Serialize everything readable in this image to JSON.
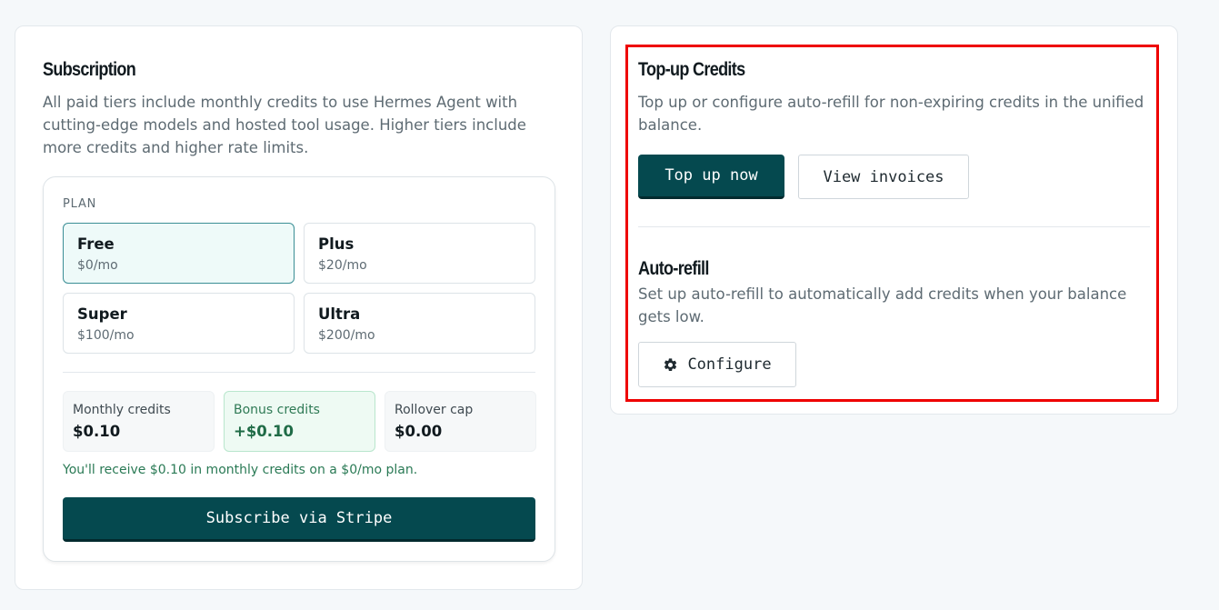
{
  "subscription": {
    "title": "Subscription",
    "description": "All paid tiers include monthly credits to use Hermes Agent with cutting-edge models and hosted tool usage. Higher tiers include more credits and higher rate limits.",
    "plan_label": "PLAN",
    "plans": [
      {
        "name": "Free",
        "price": "$0/mo",
        "selected": true
      },
      {
        "name": "Plus",
        "price": "$20/mo",
        "selected": false
      },
      {
        "name": "Super",
        "price": "$100/mo",
        "selected": false
      },
      {
        "name": "Ultra",
        "price": "$200/mo",
        "selected": false
      }
    ],
    "stats": [
      {
        "label": "Monthly credits",
        "value": "$0.10"
      },
      {
        "label": "Bonus credits",
        "value": "+$0.10"
      },
      {
        "label": "Rollover cap",
        "value": "$0.00"
      }
    ],
    "note": "You'll receive $0.10 in monthly credits on a $0/mo plan.",
    "subscribe_label": "Subscribe via Stripe"
  },
  "topup": {
    "title": "Top-up Credits",
    "description": "Top up or configure auto-refill for non-expiring credits in the unified balance.",
    "topup_label": "Top up now",
    "invoices_label": "View invoices"
  },
  "autorefill": {
    "title": "Auto-refill",
    "description": "Set up auto-refill to automatically add credits when your balance gets low.",
    "configure_label": "Configure",
    "configure_icon": "gear-icon"
  },
  "colors": {
    "primary": "#05494f",
    "highlight": "#ee0000",
    "selected_bg": "#eefaf9",
    "bonus_text": "#1f6b46"
  }
}
